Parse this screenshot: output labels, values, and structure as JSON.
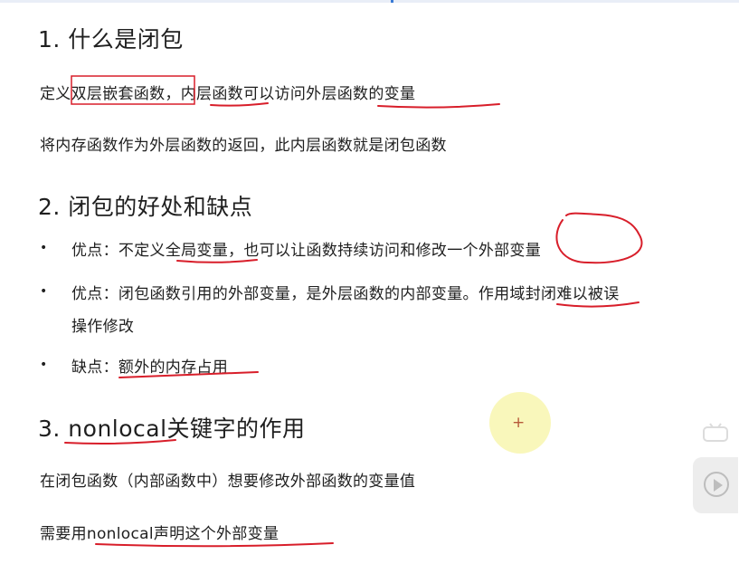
{
  "section1": {
    "heading": "1. 什么是闭包",
    "line1": {
      "a": "定义",
      "b": "双层嵌套函数",
      "c": "，",
      "d": "内层函数",
      "e": "可以访问",
      "f": "外层函数的变量"
    },
    "line2": "将内存函数作为外层函数的返回，此内层函数就是闭包函数"
  },
  "section2": {
    "heading": "2. 闭包的好处和缺点",
    "bullet_glyph": "•",
    "item1": {
      "a": "优点：不定义",
      "b": "全局变量",
      "c": "，也可以让函数持续访问和修改一个",
      "d": "外部变量"
    },
    "item2": {
      "a": "优点：闭包函数引用的外部变量，是外层函数的内部变量。",
      "b": "作用域",
      "c": "封闭难以被误",
      "d": "操作修改"
    },
    "item3": {
      "a": "缺点：",
      "b": "额外的内存占用"
    }
  },
  "section3": {
    "heading": "3. nonlocal关键字的作用",
    "line1": "在闭包函数（内部函数中）想要修改外部函数的变量值",
    "line2": "需要用nonlocal声明这个外部变量"
  },
  "overlay": {
    "cursor_glyph": "+",
    "play_icon": "play-circle-icon",
    "annotation_color": "#d81e2a",
    "highlight_color": "#f8f6af"
  }
}
